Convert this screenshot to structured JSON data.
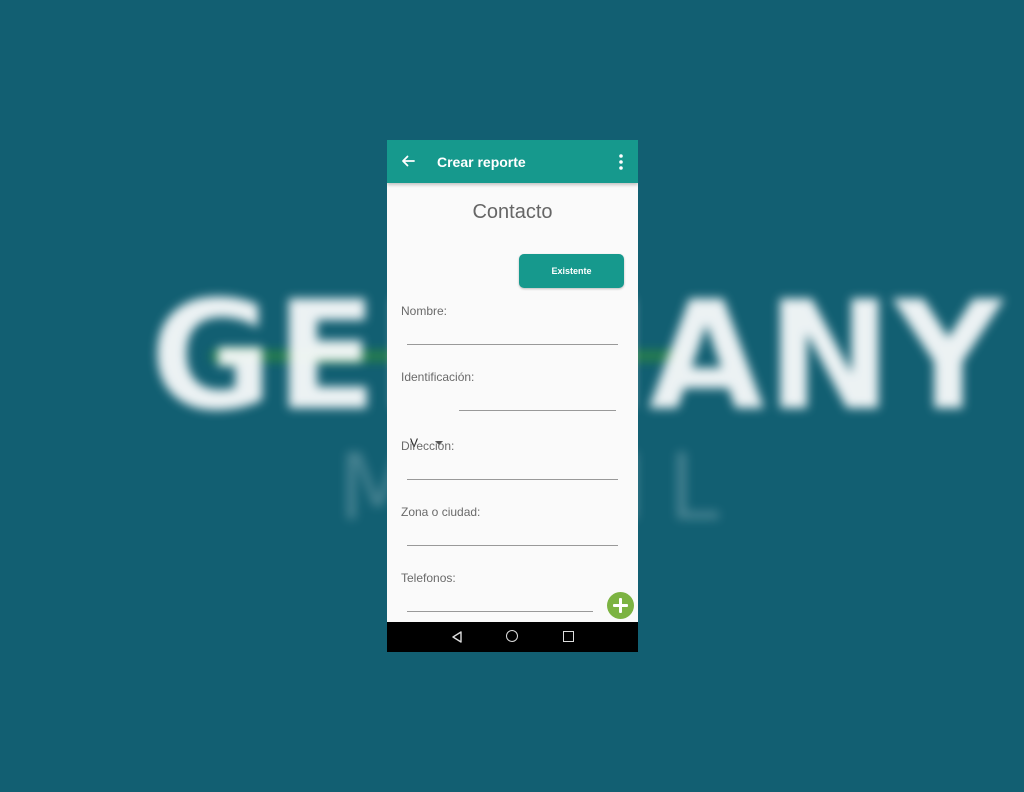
{
  "background": {
    "wordmark": "GERMANY",
    "sub_wordmark": "MOBIL"
  },
  "appbar": {
    "title": "Crear reporte",
    "back_icon": "arrow-left",
    "menu_icon": "more-vert",
    "color": "#16998d"
  },
  "form": {
    "heading": "Contacto",
    "existente_label": "Existente",
    "fields": {
      "nombre": {
        "label": "Nombre:",
        "value": ""
      },
      "identificacion": {
        "label": "Identificación:",
        "type_value": "V",
        "value": ""
      },
      "direccion": {
        "label": "Dirección:",
        "value": ""
      },
      "zona": {
        "label": "Zona o ciudad:",
        "value": ""
      },
      "telefonos": {
        "label": "Telefonos:",
        "value": ""
      }
    },
    "add_button_icon": "plus",
    "add_button_color": "#7cb342"
  },
  "navbar": {
    "icons": [
      "triangle-back",
      "circle-home",
      "square-recents"
    ]
  }
}
